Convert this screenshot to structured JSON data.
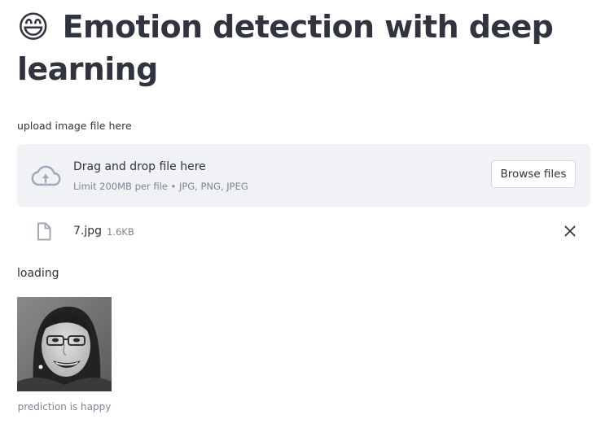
{
  "header": {
    "emoji": "😄",
    "title": "Emotion detection with deep learning"
  },
  "uploader": {
    "label": "upload image file here",
    "dropzone_title": "Drag and drop file here",
    "dropzone_subtitle": "Limit 200MB per file • JPG, PNG, JPEG",
    "browse_label": "Browse files",
    "icon": "cloud-upload-icon"
  },
  "uploaded_file": {
    "icon": "file-icon",
    "name": "7.jpg",
    "size": "1.6KB",
    "remove_icon": "close-icon"
  },
  "status": {
    "loading": "loading"
  },
  "result": {
    "caption": "prediction is happy"
  },
  "colors": {
    "text": "#31333f",
    "muted": "#808495",
    "dropzone_bg": "#f0f2f6",
    "icon": "#a3a8b8"
  }
}
